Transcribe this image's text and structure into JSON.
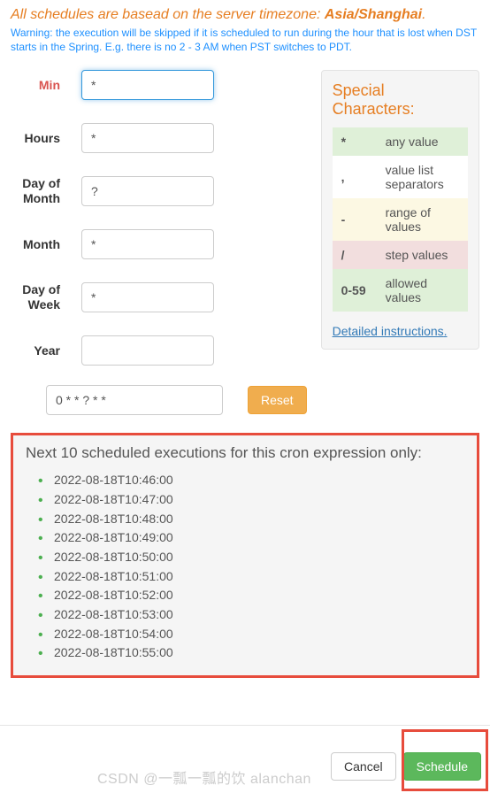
{
  "notice": {
    "text_prefix": "All schedules are basead on the server timezone: ",
    "timezone": "Asia/Shanghai",
    "suffix": "."
  },
  "dst_warning": "Warning: the execution will be skipped if it is scheduled to run during the hour that is lost when DST starts in the Spring. E.g. there is no 2 - 3 AM when PST switches to PDT.",
  "fields": {
    "min": {
      "label": "Min",
      "value": "*"
    },
    "hours": {
      "label": "Hours",
      "value": "*"
    },
    "dom": {
      "label": "Day of Month",
      "value": "?"
    },
    "month": {
      "label": "Month",
      "value": "*"
    },
    "dow": {
      "label": "Day of Week",
      "value": "*"
    },
    "year": {
      "label": "Year",
      "value": ""
    }
  },
  "cron_expression": "0 * * ? * *",
  "reset_label": "Reset",
  "special": {
    "title": "Special Characters:",
    "rows": [
      {
        "sym": "*",
        "desc": "any value"
      },
      {
        "sym": ",",
        "desc": "value list separators"
      },
      {
        "sym": "-",
        "desc": "range of values"
      },
      {
        "sym": "/",
        "desc": "step values"
      },
      {
        "sym": "0-59",
        "desc": "allowed values"
      }
    ],
    "link": "Detailed instructions"
  },
  "executions": {
    "title": "Next 10 scheduled executions for this cron expression only:",
    "items": [
      "2022-08-18T10:46:00",
      "2022-08-18T10:47:00",
      "2022-08-18T10:48:00",
      "2022-08-18T10:49:00",
      "2022-08-18T10:50:00",
      "2022-08-18T10:51:00",
      "2022-08-18T10:52:00",
      "2022-08-18T10:53:00",
      "2022-08-18T10:54:00",
      "2022-08-18T10:55:00"
    ]
  },
  "footer": {
    "cancel": "Cancel",
    "schedule": "Schedule"
  },
  "watermark": "CSDN @一瓢一瓢的饮 alanchan"
}
